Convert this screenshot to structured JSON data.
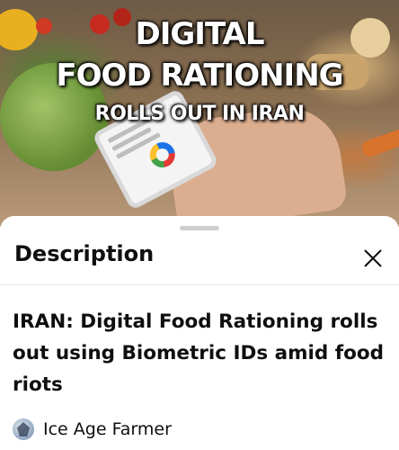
{
  "video": {
    "thumbnail_lines": [
      "DIGITAL",
      "FOOD RATIONING",
      "ROLLS OUT IN IRAN"
    ],
    "title": "IRAN: Digital Food Rationing rolls out using Biometric IDs amid food riots",
    "channel": "Ice Age Farmer"
  },
  "sheet": {
    "header": "Description",
    "close_icon": "close-icon"
  },
  "icons": {
    "close": "close-icon",
    "avatar": "channel-avatar-icon"
  },
  "colors": {
    "text": "#0f0f0f",
    "divider": "#e5e5e5",
    "handle": "#cfcfcf"
  }
}
